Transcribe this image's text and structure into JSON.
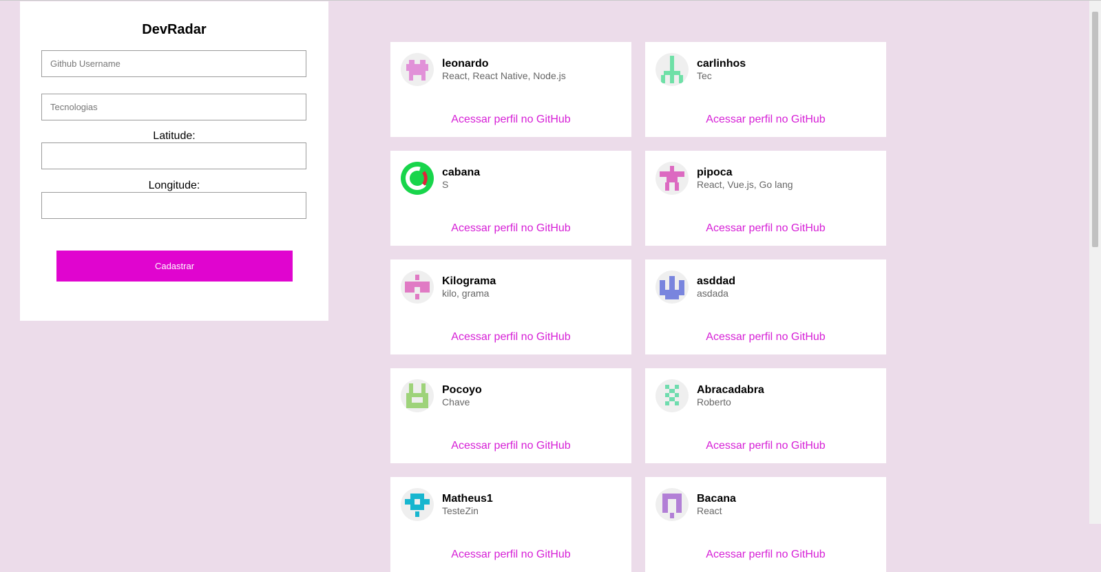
{
  "form": {
    "title": "DevRadar",
    "github_username": {
      "placeholder": "Github Username",
      "value": ""
    },
    "techs": {
      "placeholder": "Tecnologias",
      "value": ""
    },
    "latitude_label": "Latitude:",
    "latitude_value": "",
    "longitude_label": "Longitude:",
    "longitude_value": "",
    "submit_label": "Cadastrar"
  },
  "devs": [
    {
      "name": "leonardo",
      "techs": "React, React Native, Node.js",
      "link_label": "Acessar perfil no GitHub",
      "avatar_icon": "identicon-avatar-icon",
      "avatar_color": "#e191d8"
    },
    {
      "name": "carlinhos",
      "techs": "Tec",
      "link_label": "Acessar perfil no GitHub",
      "avatar_icon": "identicon-avatar-icon",
      "avatar_color": "#6fe0a7"
    },
    {
      "name": "cabana",
      "techs": "S",
      "link_label": "Acessar perfil no GitHub",
      "avatar_icon": "letter-c-logo-avatar-icon",
      "avatar_color": "#18d54b"
    },
    {
      "name": "pipoca",
      "techs": "React, Vue.js, Go lang",
      "link_label": "Acessar perfil no GitHub",
      "avatar_icon": "identicon-avatar-icon",
      "avatar_color": "#dc6ac1"
    },
    {
      "name": "Kilograma",
      "techs": "kilo, grama",
      "link_label": "Acessar perfil no GitHub",
      "avatar_icon": "identicon-avatar-icon",
      "avatar_color": "#e07ac4"
    },
    {
      "name": "asddad",
      "techs": "asdada",
      "link_label": "Acessar perfil no GitHub",
      "avatar_icon": "identicon-avatar-icon",
      "avatar_color": "#7985de"
    },
    {
      "name": "Pocoyo",
      "techs": "Chave",
      "link_label": "Acessar perfil no GitHub",
      "avatar_icon": "identicon-avatar-icon",
      "avatar_color": "#9ed37a"
    },
    {
      "name": "Abracadabra",
      "techs": "Roberto",
      "link_label": "Acessar perfil no GitHub",
      "avatar_icon": "identicon-avatar-icon",
      "avatar_color": "#6fdcae"
    },
    {
      "name": "Matheus1",
      "techs": "TesteZin",
      "link_label": "Acessar perfil no GitHub",
      "avatar_icon": "identicon-avatar-icon",
      "avatar_color": "#17b6cf"
    },
    {
      "name": "Bacana",
      "techs": "React",
      "link_label": "Acessar perfil no GitHub",
      "avatar_icon": "identicon-avatar-icon",
      "avatar_color": "#b27fd6"
    }
  ],
  "colors": {
    "background": "#ecdcea",
    "accent": "#e005cf",
    "link": "#d61ed6"
  }
}
